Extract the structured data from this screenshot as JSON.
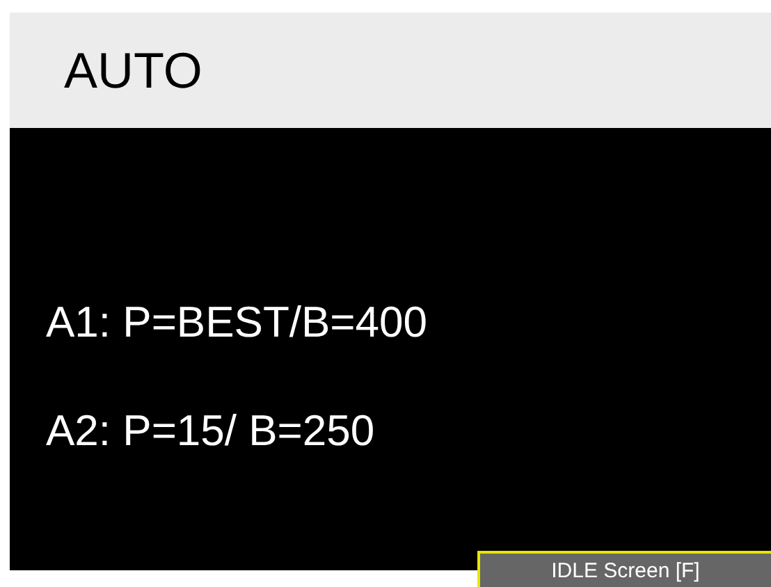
{
  "header": {
    "title": "AUTO"
  },
  "lines": [
    "A1: P=BEST/B=400",
    "A2: P=15/ B=250"
  ],
  "status_label": "IDLE Screen [F]"
}
